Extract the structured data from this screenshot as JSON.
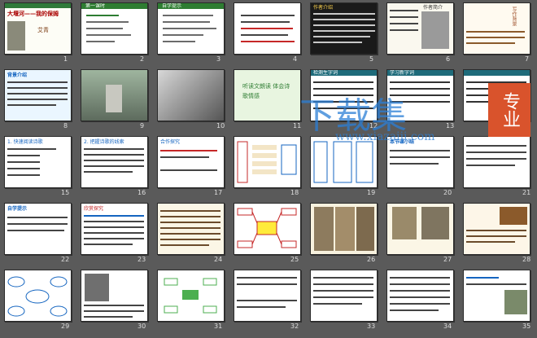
{
  "slides": [
    {
      "n": "1",
      "title": "大堰河——我的保姆",
      "subtitle": "艾青"
    },
    {
      "n": "2",
      "title": "第一课时"
    },
    {
      "n": "3",
      "title": "自学提示"
    },
    {
      "n": "4",
      "title": "三十年代末的上海，一位诗人"
    },
    {
      "n": "5",
      "title": "作者介绍"
    },
    {
      "n": "6",
      "title": "作者简介"
    },
    {
      "n": "7",
      "title": "写作背景"
    },
    {
      "n": "8",
      "title": "背景介绍"
    },
    {
      "n": "9",
      "title": ""
    },
    {
      "n": "10",
      "title": ""
    },
    {
      "n": "11",
      "title": "听读文朗读 体会诗歌情感"
    },
    {
      "n": "12",
      "title": "检测生字词"
    },
    {
      "n": "13",
      "title": "学习新字词"
    },
    {
      "n": "14",
      "title": ""
    },
    {
      "n": "15",
      "title": "1. 快速阅读诗歌"
    },
    {
      "n": "16",
      "title": "2. 把握诗歌的线索"
    },
    {
      "n": "17",
      "title": "合作探究"
    },
    {
      "n": "18",
      "title": ""
    },
    {
      "n": "19",
      "title": ""
    },
    {
      "n": "20",
      "title": "本节课小结"
    },
    {
      "n": "21",
      "title": ""
    },
    {
      "n": "22",
      "title": "自学提示"
    },
    {
      "n": "23",
      "title": "欣赏探究"
    },
    {
      "n": "24",
      "title": ""
    },
    {
      "n": "25",
      "title": ""
    },
    {
      "n": "26",
      "title": ""
    },
    {
      "n": "27",
      "title": ""
    },
    {
      "n": "28",
      "title": ""
    },
    {
      "n": "29",
      "title": ""
    },
    {
      "n": "30",
      "title": ""
    },
    {
      "n": "31",
      "title": ""
    },
    {
      "n": "32",
      "title": ""
    },
    {
      "n": "33",
      "title": ""
    },
    {
      "n": "34",
      "title": ""
    },
    {
      "n": "35",
      "title": ""
    }
  ],
  "watermark": {
    "main": "下载集",
    "side": "专业",
    "url": "www.xiazaiji.com"
  }
}
